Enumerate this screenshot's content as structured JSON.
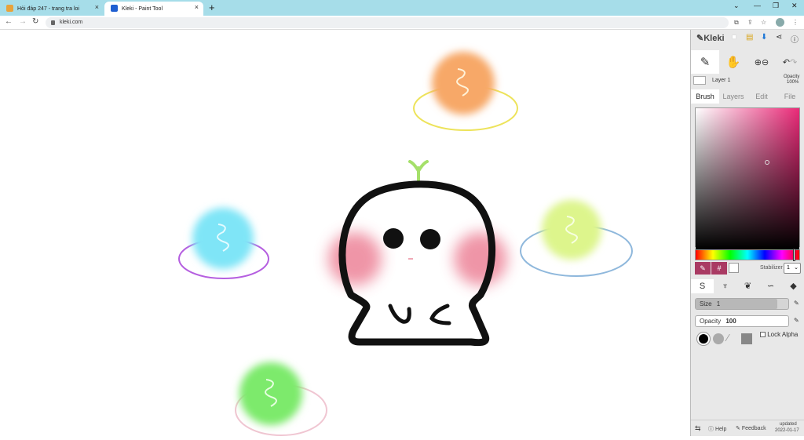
{
  "browser": {
    "tabs": [
      {
        "title": "Hỏi đáp 247 - trang tra loi",
        "favicon_color": "#e8a33c"
      },
      {
        "title": "Kleki - Paint Tool",
        "favicon_color": "#1f5fd1"
      }
    ],
    "new_tab": "+",
    "close_glyph": "×",
    "url": "kleki.com"
  },
  "app": {
    "logo": "Kleki",
    "layer": {
      "name": "Layer 1",
      "opacity_label": "Opacity",
      "opacity_value": "100%"
    },
    "tabs": [
      "Brush",
      "Layers",
      "Edit",
      "File"
    ],
    "active_tab": "Brush",
    "colors": {
      "current": "#000000",
      "picker_hue": "#ea2a78",
      "accent_button": "#a93a63"
    },
    "hex_symbol": "#",
    "stabilizer": {
      "label": "Stabilizer",
      "value": "1"
    },
    "size": {
      "label": "Size",
      "value": "1",
      "fraction": 0.88
    },
    "opacity": {
      "label": "Opacity",
      "value": "100"
    },
    "lock_alpha": "Lock Alpha",
    "footer": {
      "help": "Help",
      "feedback": "Feedback",
      "updated_label": "updated",
      "updated_date": "2022-01-17"
    }
  }
}
